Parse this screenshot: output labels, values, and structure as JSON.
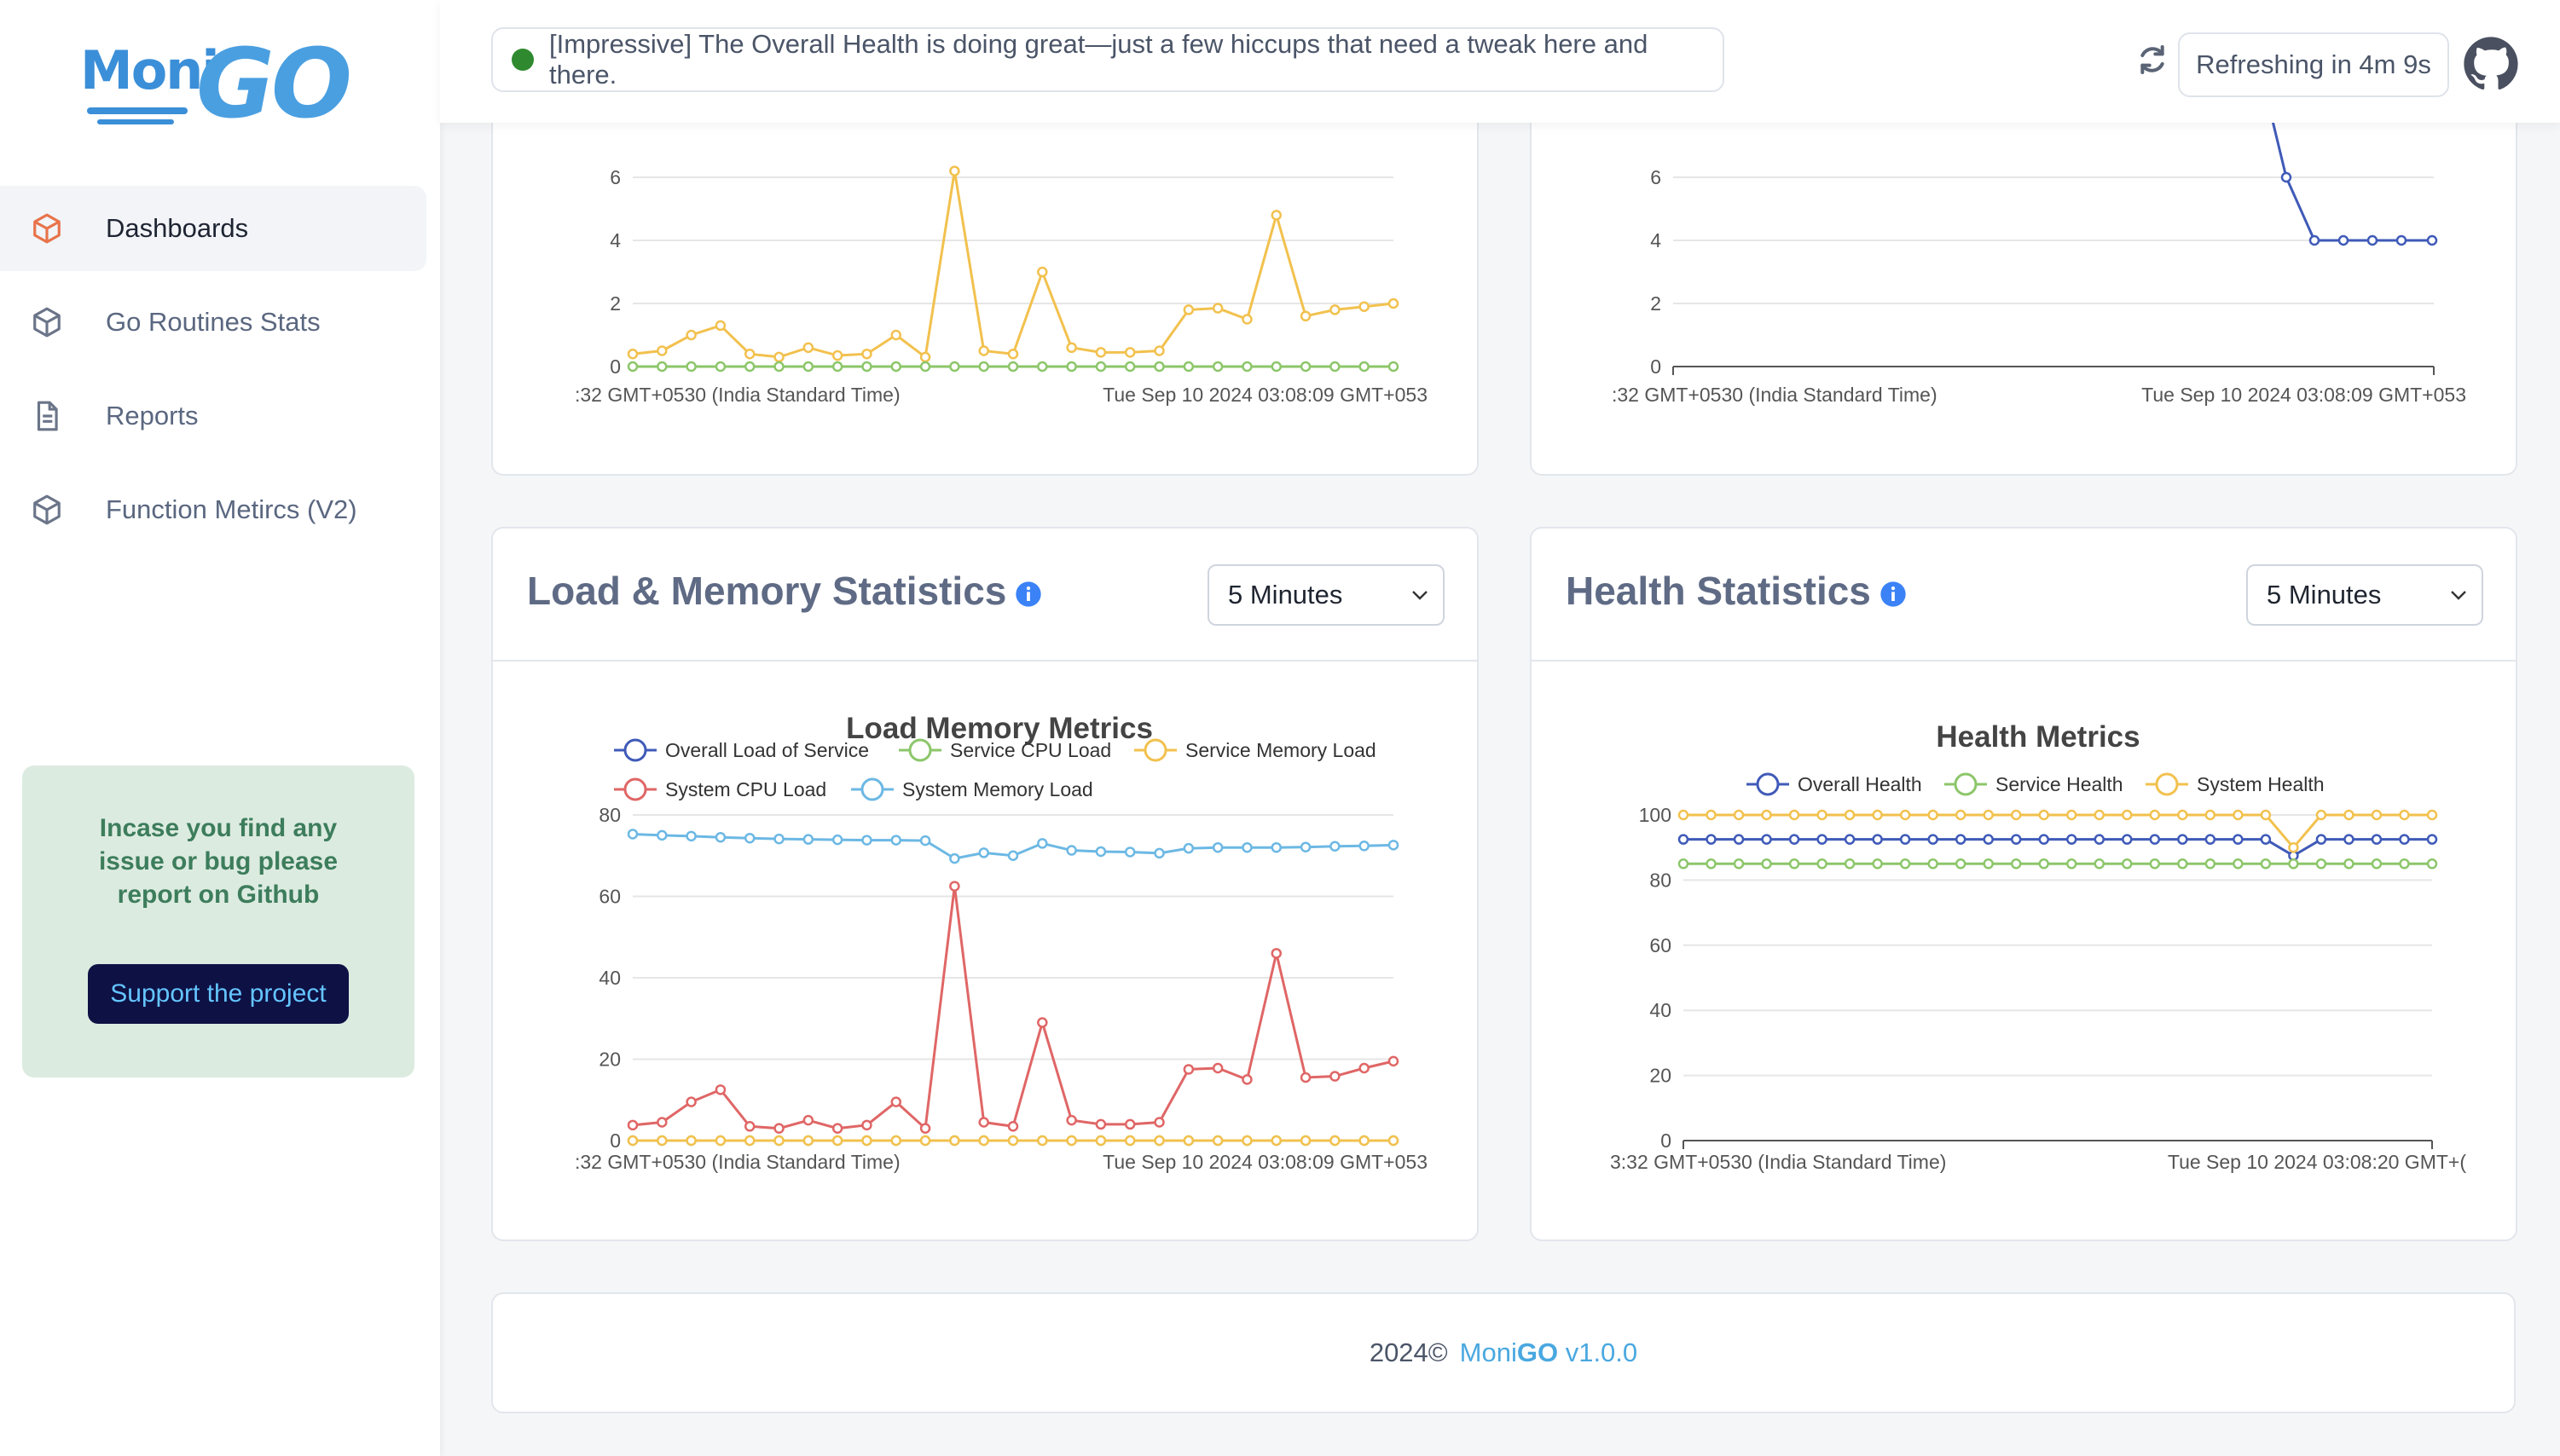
{
  "app": {
    "logo_moni": "Moni",
    "logo_go": "GO"
  },
  "sidebar": {
    "items": [
      {
        "label": "Dashboards",
        "icon": "cube-icon",
        "active": true
      },
      {
        "label": "Go Routines Stats",
        "icon": "cube-icon",
        "active": false
      },
      {
        "label": "Reports",
        "icon": "document-icon",
        "active": false
      },
      {
        "label": "Function Metircs (V2)",
        "icon": "cube-icon",
        "active": false
      }
    ],
    "support": {
      "message": "Incase you find any issue or bug please report on Github",
      "button_label": "Support the project"
    }
  },
  "header": {
    "status_text": "[Impressive] The Overall Health is doing great—just a few hiccups that need a tweak here and there.",
    "status_color": "#2f8a2f",
    "refresh_text": "Refreshing in 4m 9s",
    "refresh_icon": "refresh-icon",
    "github_icon": "github-icon"
  },
  "top_left_chart": {
    "x_start_label": ":32 GMT+0530 (India Standard Time)",
    "x_end_label": "Tue Sep 10 2024 03:08:09 GMT+053",
    "y_ticks": [
      "0",
      "2",
      "4",
      "6"
    ]
  },
  "top_right_chart": {
    "x_start_label": ":32 GMT+0530 (India Standard Time)",
    "x_end_label": "Tue Sep 10 2024 03:08:09 GMT+053",
    "y_ticks": [
      "0",
      "2",
      "4",
      "6"
    ]
  },
  "load_card": {
    "title": "Load & Memory Statistics",
    "range_value": "5 Minutes",
    "chart_title": "Load Memory Metrics",
    "x_start_label": ":32 GMT+0530 (India Standard Time)",
    "x_end_label": "Tue Sep 10 2024 03:08:09 GMT+053",
    "y_ticks": [
      "0",
      "20",
      "40",
      "60",
      "80"
    ]
  },
  "health_card": {
    "title": "Health Statistics",
    "range_value": "5 Minutes",
    "chart_title": "Health Metrics",
    "x_start_label": "3:32 GMT+0530 (India Standard Time)",
    "x_end_label": "Tue Sep 10 2024 03:08:20 GMT+(",
    "y_ticks": [
      "0",
      "20",
      "40",
      "60",
      "80",
      "100"
    ]
  },
  "footer": {
    "copyright": "2024©",
    "brand_prefix": "Moni",
    "brand_bold": "GO",
    "version": "v1.0.0"
  },
  "chart_data": [
    {
      "type": "line",
      "title": "",
      "ylim": [
        0,
        7
      ],
      "series": [
        {
          "name": "",
          "color": "#f2c14e",
          "values": [
            0.4,
            0.5,
            1.0,
            1.3,
            0.4,
            0.3,
            0.6,
            0.35,
            0.4,
            1.0,
            0.3,
            6.2,
            0.5,
            0.4,
            3.0,
            0.6,
            0.45,
            0.45,
            0.5,
            1.8,
            1.85,
            1.5,
            4.8,
            1.6,
            1.8,
            1.9,
            2.0
          ]
        },
        {
          "name": "",
          "color": "#8cc66a",
          "values": [
            0,
            0,
            0,
            0,
            0,
            0,
            0,
            0,
            0,
            0,
            0,
            0,
            0,
            0,
            0,
            0,
            0,
            0,
            0,
            0,
            0,
            0,
            0,
            0,
            0,
            0,
            0
          ]
        }
      ]
    },
    {
      "type": "line",
      "title": "",
      "ylim": [
        0,
        7
      ],
      "series": [
        {
          "name": "",
          "color": "#3f5ab8",
          "values": [
            7.9,
            6.0,
            4.0,
            4.0,
            4.0,
            4.0,
            4.0
          ]
        }
      ]
    },
    {
      "type": "line",
      "title": "Load Memory Metrics",
      "ylim": [
        0,
        80
      ],
      "legend": "top",
      "series": [
        {
          "name": "Overall Load of Service",
          "color": "#3f5ab8",
          "values": []
        },
        {
          "name": "Service CPU Load",
          "color": "#8cc66a",
          "values": [
            0,
            0,
            0,
            0,
            0,
            0,
            0,
            0,
            0,
            0,
            0,
            0,
            0,
            0,
            0,
            0,
            0,
            0,
            0,
            0,
            0,
            0,
            0,
            0,
            0,
            0,
            0
          ]
        },
        {
          "name": "Service Memory Load",
          "color": "#f2c14e",
          "values": [
            0,
            0,
            0,
            0,
            0,
            0,
            0,
            0,
            0,
            0,
            0,
            0,
            0,
            0,
            0,
            0,
            0,
            0,
            0,
            0,
            0,
            0,
            0,
            0,
            0,
            0,
            0
          ]
        },
        {
          "name": "System CPU Load",
          "color": "#e06666",
          "values": [
            3.8,
            4.5,
            9.5,
            12.5,
            3.5,
            3,
            5,
            3,
            3.8,
            9.5,
            3,
            62.5,
            4.5,
            3.5,
            29,
            5,
            4,
            4,
            4.5,
            17.5,
            17.8,
            15,
            46,
            15.5,
            15.8,
            17.8,
            19.5
          ]
        },
        {
          "name": "System Memory Load",
          "color": "#6cb8e4",
          "values": [
            75.3,
            75,
            74.8,
            74.5,
            74.3,
            74.1,
            74,
            73.9,
            73.8,
            73.8,
            73.7,
            69.3,
            70.7,
            70,
            73,
            71.3,
            71,
            70.9,
            70.6,
            71.8,
            72,
            72,
            72,
            72.1,
            72.3,
            72.4,
            72.6
          ]
        }
      ]
    },
    {
      "type": "line",
      "title": "Health Metrics",
      "ylim": [
        0,
        100
      ],
      "legend": "top",
      "series": [
        {
          "name": "Overall Health",
          "color": "#3f5ab8",
          "values": [
            92.5,
            92.5,
            92.5,
            92.5,
            92.5,
            92.5,
            92.5,
            92.5,
            92.5,
            92.5,
            92.5,
            92.5,
            92.5,
            92.5,
            92.5,
            92.5,
            92.5,
            92.5,
            92.5,
            92.5,
            92.5,
            92.5,
            87.5,
            92.5,
            92.5,
            92.5,
            92.5,
            92.5
          ]
        },
        {
          "name": "Service Health",
          "color": "#8cc66a",
          "values": [
            85,
            85,
            85,
            85,
            85,
            85,
            85,
            85,
            85,
            85,
            85,
            85,
            85,
            85,
            85,
            85,
            85,
            85,
            85,
            85,
            85,
            85,
            85,
            85,
            85,
            85,
            85,
            85
          ]
        },
        {
          "name": "System Health",
          "color": "#f2c14e",
          "values": [
            100,
            100,
            100,
            100,
            100,
            100,
            100,
            100,
            100,
            100,
            100,
            100,
            100,
            100,
            100,
            100,
            100,
            100,
            100,
            100,
            100,
            100,
            90,
            100,
            100,
            100,
            100,
            100
          ]
        }
      ]
    }
  ]
}
